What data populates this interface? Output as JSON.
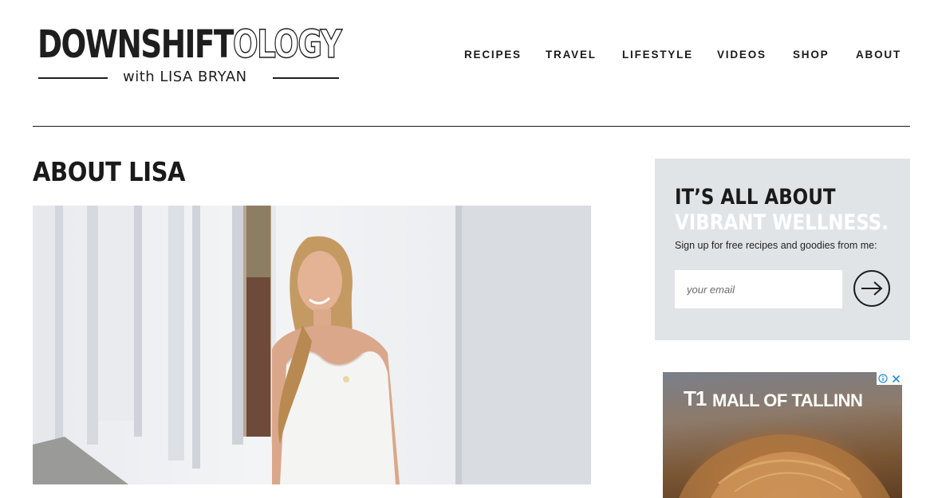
{
  "brand": {
    "name_bold": "DOWNSHIFT",
    "name_outline": "OLOGY",
    "tagline": "with LISA BRYAN"
  },
  "nav": {
    "items": [
      {
        "label": "RECIPES"
      },
      {
        "label": "TRAVEL"
      },
      {
        "label": "LIFESTYLE"
      },
      {
        "label": "VIDEOS"
      },
      {
        "label": "SHOP"
      },
      {
        "label": "ABOUT"
      }
    ]
  },
  "main": {
    "title": "ABOUT LISA"
  },
  "signup": {
    "heading_line1": "IT’S ALL ABOUT",
    "heading_line2": "VIBRANT WELLNESS.",
    "text": "Sign up for free recipes and goodies from me:",
    "email_placeholder": "your email",
    "submit_icon": "arrow-right-circle-icon"
  },
  "ad": {
    "logo": "T1",
    "text": "MALL OF TALLINN",
    "choices_icons": [
      "adchoices-icon",
      "close-icon"
    ]
  },
  "colors": {
    "text": "#1a1a1a",
    "signup_bg": "#e1e4e7",
    "accent_white": "#ffffff"
  }
}
